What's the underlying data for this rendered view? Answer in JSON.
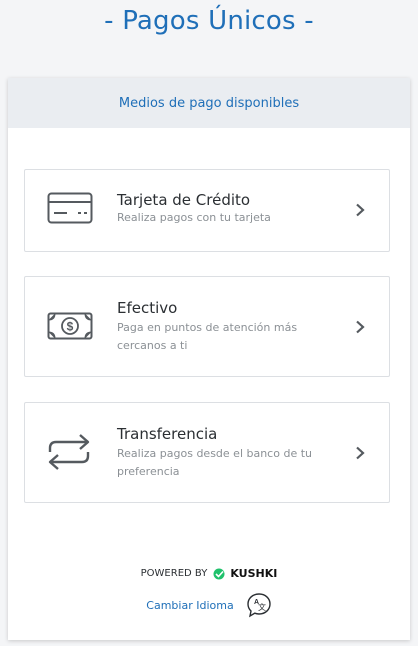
{
  "header": {
    "title": "- Pagos Únicos -"
  },
  "card": {
    "header_label": "Medios de pago disponibles"
  },
  "payment_options": [
    {
      "title": "Tarjeta de Crédito",
      "subtitle": "Realiza pagos con tu tarjeta",
      "icon": "credit-card-icon"
    },
    {
      "title": "Efectivo",
      "subtitle": "Paga en puntos de atención más cercanos a ti",
      "icon": "cash-icon"
    },
    {
      "title": "Transferencia",
      "subtitle": "Realiza pagos desde el banco de tu preferencia",
      "icon": "transfer-icon"
    }
  ],
  "footer": {
    "powered_by": "POWERED BY",
    "brand": "KUSHKI",
    "change_language": "Cambiar Idioma"
  },
  "colors": {
    "accent": "#1f6fb8",
    "header_bg": "#eaedf1",
    "border": "#dcdfe3"
  }
}
